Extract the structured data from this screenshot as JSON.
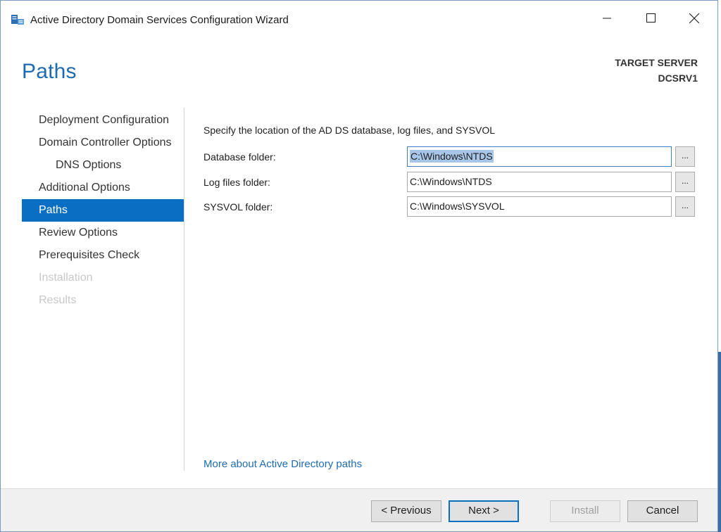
{
  "window": {
    "title": "Active Directory Domain Services Configuration Wizard",
    "icon": "server-role-icon",
    "controls": [
      "minimize-icon",
      "maximize-icon",
      "close-icon"
    ]
  },
  "header": {
    "page_title": "Paths",
    "target_label": "TARGET SERVER",
    "target_name": "DCSRV1"
  },
  "nav": {
    "items": [
      {
        "label": "Deployment Configuration",
        "state": "normal"
      },
      {
        "label": "Domain Controller Options",
        "state": "normal"
      },
      {
        "label": "DNS Options",
        "state": "sub"
      },
      {
        "label": "Additional Options",
        "state": "normal"
      },
      {
        "label": "Paths",
        "state": "active"
      },
      {
        "label": "Review Options",
        "state": "normal"
      },
      {
        "label": "Prerequisites Check",
        "state": "normal"
      },
      {
        "label": "Installation",
        "state": "disabled"
      },
      {
        "label": "Results",
        "state": "disabled"
      }
    ]
  },
  "content": {
    "description": "Specify the location of the AD DS database, log files, and SYSVOL",
    "fields": [
      {
        "label": "Database folder:",
        "value": "C:\\Windows\\NTDS",
        "browse": "..."
      },
      {
        "label": "Log files folder:",
        "value": "C:\\Windows\\NTDS",
        "browse": "..."
      },
      {
        "label": "SYSVOL folder:",
        "value": "C:\\Windows\\SYSVOL",
        "browse": "..."
      }
    ],
    "more_link": "More about Active Directory paths"
  },
  "footer": {
    "previous": "< Previous",
    "next": "Next >",
    "install": "Install",
    "cancel": "Cancel"
  },
  "colors": {
    "accent": "#0a6fc2",
    "title_blue": "#1e6bb0",
    "selection": "#a7c6e8"
  }
}
